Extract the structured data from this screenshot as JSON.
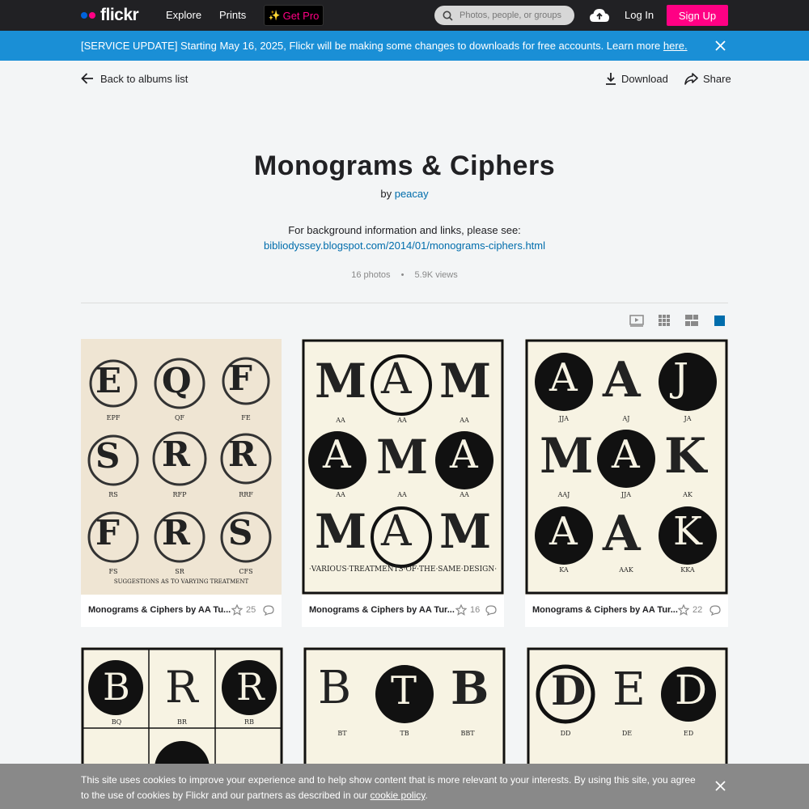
{
  "nav": {
    "logo": "flickr",
    "explore": "Explore",
    "prints": "Prints",
    "get_pro": "Get Pro",
    "search_placeholder": "Photos, people, or groups",
    "login": "Log In",
    "signup": "Sign Up"
  },
  "banner": {
    "text": "[SERVICE UPDATE] Starting May 16, 2025, Flickr will be making some changes to downloads for free accounts. Learn more",
    "link": "here."
  },
  "toolbar": {
    "back": "Back to albums list",
    "download": "Download",
    "share": "Share"
  },
  "album": {
    "title": "Monograms & Ciphers",
    "by": "by",
    "author": "peacay",
    "description": "For background information and links, please see:",
    "link": "bibliodyssey.blogspot.com/2014/01/monograms-ciphers.html",
    "photos": "16 photos",
    "views": "5.9K views"
  },
  "photos": [
    {
      "caption": "Monograms & Ciphers by AA Tu...",
      "faves": "25",
      "labels": [
        "EPF",
        "QF",
        "FE",
        "RS",
        "RFP",
        "RRF",
        "FS",
        "SR",
        "CFS"
      ],
      "footer": "SUGGESTIONS AS TO VARYING TREATMENT"
    },
    {
      "caption": "Monograms & Ciphers by AA Tur...",
      "faves": "16",
      "labels": [
        "AA",
        "AA",
        "AA",
        "AA",
        "AA",
        "AA"
      ],
      "footer": "·VARIOUS·TREATMENTS·OF·THE·SAME·DESIGN·"
    },
    {
      "caption": "Monograms & Ciphers by AA Tur...",
      "faves": "22",
      "labels": [
        "JJA",
        "AJ",
        "JA",
        "AAJ",
        "JJA",
        "AK",
        "KA",
        "AAK",
        "KKA"
      ]
    },
    {
      "labels": [
        "BQ",
        "BR",
        "RB"
      ]
    },
    {
      "labels": [
        "BT",
        "TB",
        "BBT"
      ]
    },
    {
      "labels": [
        "DD",
        "DE",
        "ED"
      ]
    }
  ],
  "cookie": {
    "text": "This site uses cookies to improve your experience and to help show content that is more relevant to your interests. By using this site, you agree to the use of cookies by Flickr and our partners as described in our",
    "link": "cookie policy",
    "end": "."
  },
  "colors": {
    "nav_bg": "#212124",
    "banner_bg": "#1a8fd6",
    "accent_pink": "#ff0084",
    "link_blue": "#006dac",
    "cookie_bg": "#898989"
  }
}
